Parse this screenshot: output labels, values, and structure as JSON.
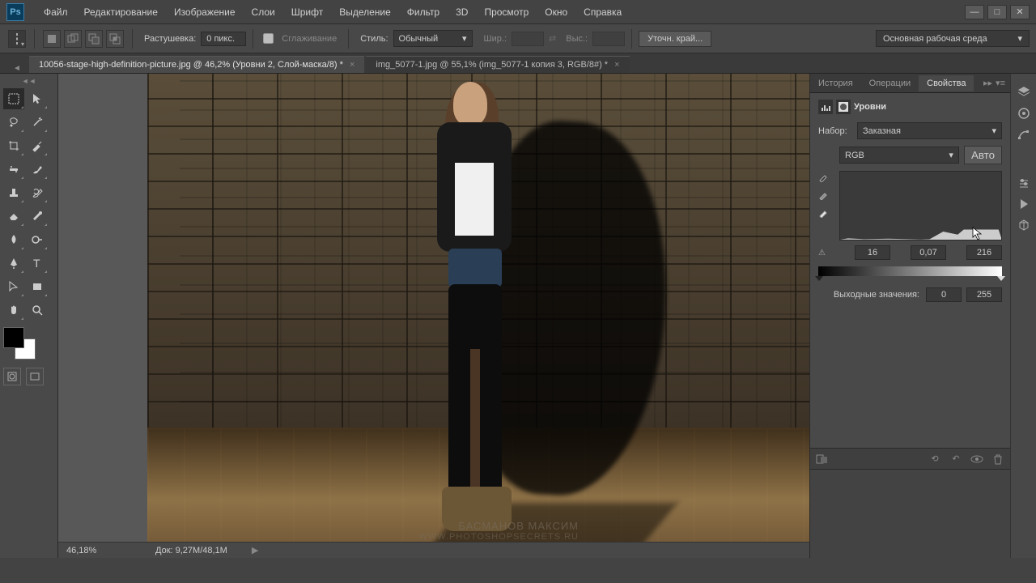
{
  "menu": {
    "items": [
      "Файл",
      "Редактирование",
      "Изображение",
      "Слои",
      "Шрифт",
      "Выделение",
      "Фильтр",
      "3D",
      "Просмотр",
      "Окно",
      "Справка"
    ]
  },
  "options": {
    "feather_label": "Растушевка:",
    "feather_value": "0 пикс.",
    "antialias_label": "Сглаживание",
    "style_label": "Стиль:",
    "style_value": "Обычный",
    "width_label": "Шир.:",
    "height_label": "Выс.:",
    "refine_label": "Уточн. край...",
    "workspace": "Основная рабочая среда"
  },
  "tabs": {
    "active": "10056-stage-high-definition-picture.jpg @ 46,2% (Уровни 2, Слой-маска/8) *",
    "second": "img_5077-1.jpg @ 55,1% (img_5077-1 копия 3, RGB/8#) *"
  },
  "panels": {
    "tabs": [
      "История",
      "Операции",
      "Свойства"
    ],
    "properties_title": "Уровни",
    "preset_label": "Набор:",
    "preset_value": "Заказная",
    "channel_value": "RGB",
    "auto_label": "Авто",
    "levels": {
      "black": "16",
      "gamma": "0,07",
      "white": "216"
    },
    "output_label": "Выходные значения:",
    "output_black": "0",
    "output_white": "255"
  },
  "status": {
    "zoom": "46,18%",
    "docsize": "Док: 9,27M/48,1M"
  },
  "watermark": {
    "line1": "Басманов Максим",
    "line2": "www.photoshopsecrets.ru"
  }
}
